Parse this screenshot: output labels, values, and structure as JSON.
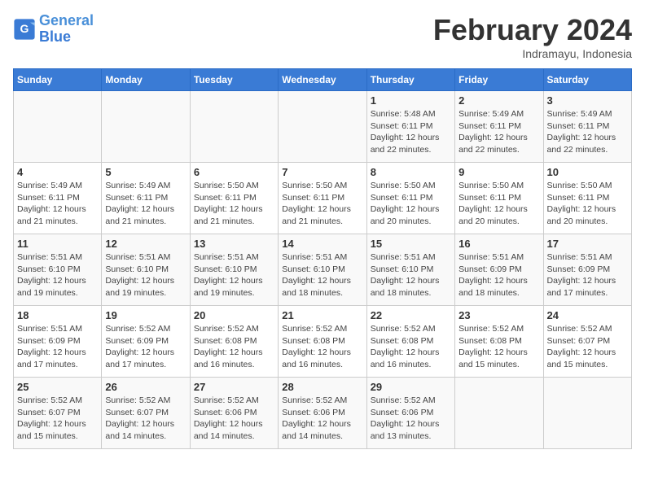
{
  "header": {
    "logo_line1": "General",
    "logo_line2": "Blue",
    "title": "February 2024",
    "subtitle": "Indramayu, Indonesia"
  },
  "calendar": {
    "days_of_week": [
      "Sunday",
      "Monday",
      "Tuesday",
      "Wednesday",
      "Thursday",
      "Friday",
      "Saturday"
    ],
    "weeks": [
      [
        {
          "day": "",
          "info": ""
        },
        {
          "day": "",
          "info": ""
        },
        {
          "day": "",
          "info": ""
        },
        {
          "day": "",
          "info": ""
        },
        {
          "day": "1",
          "info": "Sunrise: 5:48 AM\nSunset: 6:11 PM\nDaylight: 12 hours\nand 22 minutes."
        },
        {
          "day": "2",
          "info": "Sunrise: 5:49 AM\nSunset: 6:11 PM\nDaylight: 12 hours\nand 22 minutes."
        },
        {
          "day": "3",
          "info": "Sunrise: 5:49 AM\nSunset: 6:11 PM\nDaylight: 12 hours\nand 22 minutes."
        }
      ],
      [
        {
          "day": "4",
          "info": "Sunrise: 5:49 AM\nSunset: 6:11 PM\nDaylight: 12 hours\nand 21 minutes."
        },
        {
          "day": "5",
          "info": "Sunrise: 5:49 AM\nSunset: 6:11 PM\nDaylight: 12 hours\nand 21 minutes."
        },
        {
          "day": "6",
          "info": "Sunrise: 5:50 AM\nSunset: 6:11 PM\nDaylight: 12 hours\nand 21 minutes."
        },
        {
          "day": "7",
          "info": "Sunrise: 5:50 AM\nSunset: 6:11 PM\nDaylight: 12 hours\nand 21 minutes."
        },
        {
          "day": "8",
          "info": "Sunrise: 5:50 AM\nSunset: 6:11 PM\nDaylight: 12 hours\nand 20 minutes."
        },
        {
          "day": "9",
          "info": "Sunrise: 5:50 AM\nSunset: 6:11 PM\nDaylight: 12 hours\nand 20 minutes."
        },
        {
          "day": "10",
          "info": "Sunrise: 5:50 AM\nSunset: 6:11 PM\nDaylight: 12 hours\nand 20 minutes."
        }
      ],
      [
        {
          "day": "11",
          "info": "Sunrise: 5:51 AM\nSunset: 6:10 PM\nDaylight: 12 hours\nand 19 minutes."
        },
        {
          "day": "12",
          "info": "Sunrise: 5:51 AM\nSunset: 6:10 PM\nDaylight: 12 hours\nand 19 minutes."
        },
        {
          "day": "13",
          "info": "Sunrise: 5:51 AM\nSunset: 6:10 PM\nDaylight: 12 hours\nand 19 minutes."
        },
        {
          "day": "14",
          "info": "Sunrise: 5:51 AM\nSunset: 6:10 PM\nDaylight: 12 hours\nand 18 minutes."
        },
        {
          "day": "15",
          "info": "Sunrise: 5:51 AM\nSunset: 6:10 PM\nDaylight: 12 hours\nand 18 minutes."
        },
        {
          "day": "16",
          "info": "Sunrise: 5:51 AM\nSunset: 6:09 PM\nDaylight: 12 hours\nand 18 minutes."
        },
        {
          "day": "17",
          "info": "Sunrise: 5:51 AM\nSunset: 6:09 PM\nDaylight: 12 hours\nand 17 minutes."
        }
      ],
      [
        {
          "day": "18",
          "info": "Sunrise: 5:51 AM\nSunset: 6:09 PM\nDaylight: 12 hours\nand 17 minutes."
        },
        {
          "day": "19",
          "info": "Sunrise: 5:52 AM\nSunset: 6:09 PM\nDaylight: 12 hours\nand 17 minutes."
        },
        {
          "day": "20",
          "info": "Sunrise: 5:52 AM\nSunset: 6:08 PM\nDaylight: 12 hours\nand 16 minutes."
        },
        {
          "day": "21",
          "info": "Sunrise: 5:52 AM\nSunset: 6:08 PM\nDaylight: 12 hours\nand 16 minutes."
        },
        {
          "day": "22",
          "info": "Sunrise: 5:52 AM\nSunset: 6:08 PM\nDaylight: 12 hours\nand 16 minutes."
        },
        {
          "day": "23",
          "info": "Sunrise: 5:52 AM\nSunset: 6:08 PM\nDaylight: 12 hours\nand 15 minutes."
        },
        {
          "day": "24",
          "info": "Sunrise: 5:52 AM\nSunset: 6:07 PM\nDaylight: 12 hours\nand 15 minutes."
        }
      ],
      [
        {
          "day": "25",
          "info": "Sunrise: 5:52 AM\nSunset: 6:07 PM\nDaylight: 12 hours\nand 15 minutes."
        },
        {
          "day": "26",
          "info": "Sunrise: 5:52 AM\nSunset: 6:07 PM\nDaylight: 12 hours\nand 14 minutes."
        },
        {
          "day": "27",
          "info": "Sunrise: 5:52 AM\nSunset: 6:06 PM\nDaylight: 12 hours\nand 14 minutes."
        },
        {
          "day": "28",
          "info": "Sunrise: 5:52 AM\nSunset: 6:06 PM\nDaylight: 12 hours\nand 14 minutes."
        },
        {
          "day": "29",
          "info": "Sunrise: 5:52 AM\nSunset: 6:06 PM\nDaylight: 12 hours\nand 13 minutes."
        },
        {
          "day": "",
          "info": ""
        },
        {
          "day": "",
          "info": ""
        }
      ]
    ]
  }
}
